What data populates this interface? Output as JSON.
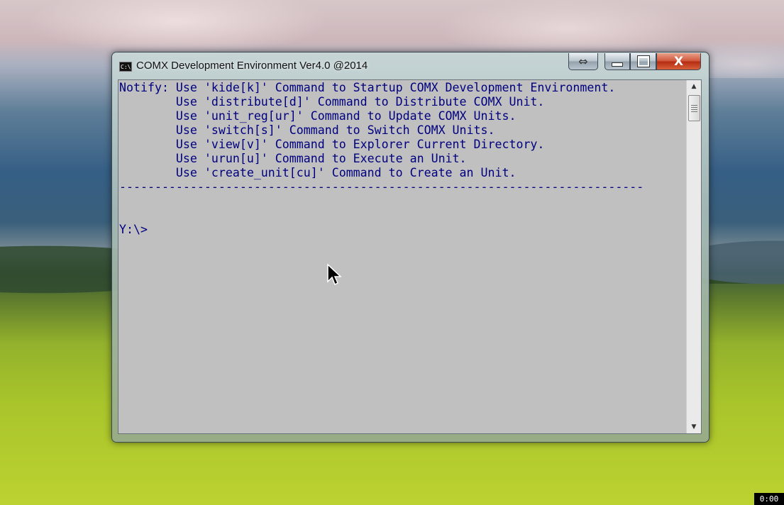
{
  "window": {
    "title": "COMX Development Environment Ver4.0 @2014",
    "icon": "console-icon",
    "icon_text": "C:\\",
    "buttons": {
      "resize_glyph": "⇔",
      "close_glyph": "X"
    }
  },
  "console": {
    "text_color": "#000080",
    "background": "#c0c0c0",
    "lines": [
      "Notify: Use 'kide[k]' Command to Startup COMX Development Environment.",
      "        Use 'distribute[d]' Command to Distribute COMX Unit.",
      "        Use 'unit_reg[ur]' Command to Update COMX Units.",
      "        Use 'switch[s]' Command to Switch COMX Units.",
      "        Use 'view[v]' Command to Explorer Current Directory.",
      "        Use 'urun[u]' Command to Execute an Unit.",
      "        Use 'create_unit[cu]' Command to Create an Unit.",
      "--------------------------------------------------------------------------",
      "",
      "",
      "Y:\\>"
    ]
  },
  "overlay": {
    "timer": "0:00"
  }
}
